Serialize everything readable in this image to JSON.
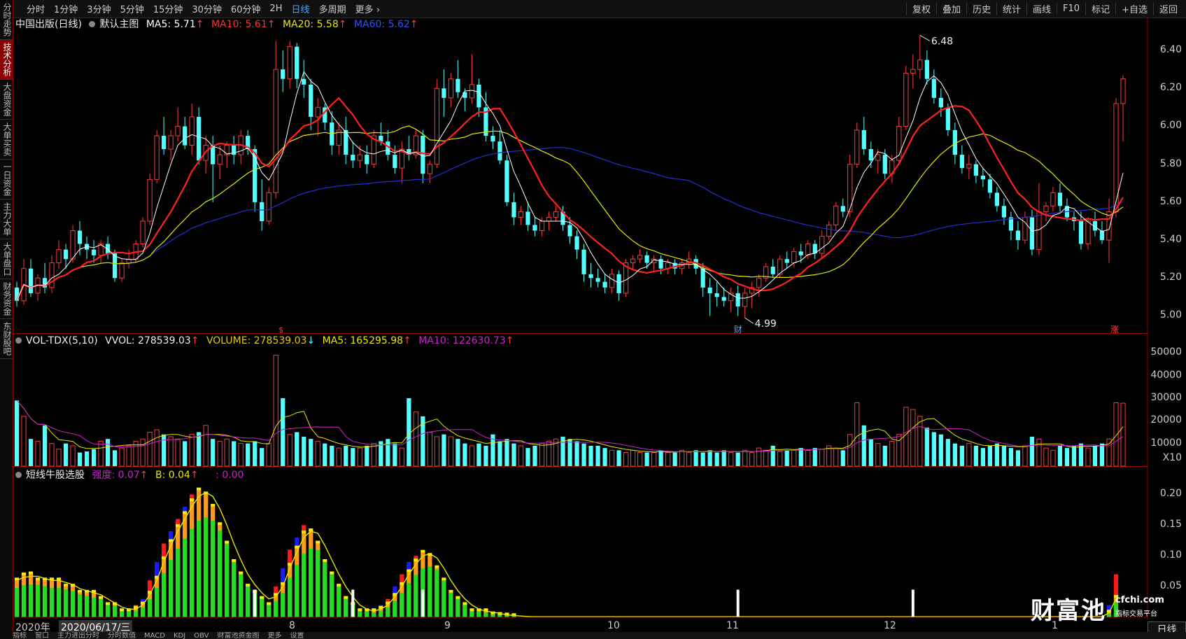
{
  "toolbar": {
    "periods": [
      "分时",
      "1分钟",
      "3分钟",
      "5分钟",
      "15分钟",
      "30分钟",
      "60分钟",
      "2H",
      "日线",
      "多周期",
      "更多"
    ],
    "tools": [
      "复权",
      "叠加",
      "历史",
      "统计",
      "画线",
      "F10",
      "标记",
      "+自选",
      "返回"
    ]
  },
  "sidebar": [
    "分时走势",
    "技术分析",
    "大盘资金",
    "大单买卖",
    "一日资金",
    "主力大单",
    "大单盘口",
    "财务资金",
    "东财股吧"
  ],
  "main_legend": {
    "name": "中国出版(日线)",
    "indicator": "默认主图",
    "ma5": "MA5: 5.71",
    "ma10": "MA10: 5.61",
    "ma20": "MA20: 5.58",
    "ma60": "MA60: 5.62",
    "arrow": "↑"
  },
  "vol_legend": {
    "name": "VOL-TDX(5,10)",
    "vvol": "VVOL: 278539.03",
    "volume": "VOLUME: 278539.03",
    "ma5": "MA5: 165295.98",
    "ma10": "MA10: 122630.73"
  },
  "ind_legend": {
    "name": "短线牛股选股",
    "strength": "强度: 0.07",
    "b": "B: 0.04",
    "blank": ": 0.00"
  },
  "price_axis": [
    "6.40",
    "6.20",
    "6.00",
    "5.80",
    "5.60",
    "5.40",
    "5.20",
    "5.00"
  ],
  "vol_axis": [
    "50000",
    "40000",
    "30000",
    "20000",
    "10000",
    "X10"
  ],
  "ind_axis": [
    "0.20",
    "0.15",
    "0.10",
    "0.05"
  ],
  "annotations": {
    "high": "6.48",
    "low": "4.99",
    "fin": "财",
    "up": "涨",
    "s_mark": "$"
  },
  "date_axis": {
    "year": "2020年",
    "cursor_date": "2020/06/17/三",
    "months": [
      "8",
      "9",
      "10",
      "11",
      "12",
      "1"
    ]
  },
  "right_bottom": "日线",
  "bottom_tabs": [
    "指标",
    "窗口",
    "主力进出分时",
    "分时数值",
    "MACD",
    "KDJ",
    "OBV",
    "财富池资金图",
    "更多",
    "设置"
  ],
  "watermark": {
    "logo": "财富池",
    "site": "cfchi.com",
    "sub": "指标交易平台"
  },
  "colors": {
    "up": "#ff3b3b",
    "down": "#54ffff",
    "ma5": "#ffffff",
    "ma10": "#ff2020",
    "ma20": "#e6e600",
    "ma60": "#2030d0",
    "vma10": "#d020d0",
    "accent": "#4aa3ff"
  },
  "chart_data": {
    "type": "candlestick",
    "price_range": [
      4.95,
      6.5
    ],
    "ohlc": [
      [
        5.15,
        5.18,
        5.05,
        5.08
      ],
      [
        5.08,
        5.3,
        5.06,
        5.25
      ],
      [
        5.25,
        5.3,
        5.1,
        5.12
      ],
      [
        5.12,
        5.22,
        5.08,
        5.2
      ],
      [
        5.2,
        5.28,
        5.12,
        5.15
      ],
      [
        5.15,
        5.32,
        5.12,
        5.28
      ],
      [
        5.28,
        5.4,
        5.25,
        5.35
      ],
      [
        5.35,
        5.38,
        5.25,
        5.3
      ],
      [
        5.3,
        5.48,
        5.28,
        5.45
      ],
      [
        5.45,
        5.5,
        5.32,
        5.38
      ],
      [
        5.38,
        5.42,
        5.3,
        5.35
      ],
      [
        5.35,
        5.4,
        5.28,
        5.32
      ],
      [
        5.32,
        5.4,
        5.28,
        5.38
      ],
      [
        5.38,
        5.42,
        5.3,
        5.33
      ],
      [
        5.33,
        5.35,
        5.18,
        5.2
      ],
      [
        5.2,
        5.3,
        5.18,
        5.28
      ],
      [
        5.28,
        5.35,
        5.25,
        5.3
      ],
      [
        5.3,
        5.4,
        5.28,
        5.38
      ],
      [
        5.38,
        5.52,
        5.36,
        5.5
      ],
      [
        5.5,
        5.75,
        5.48,
        5.72
      ],
      [
        5.72,
        5.98,
        5.7,
        5.95
      ],
      [
        5.95,
        6.05,
        5.85,
        5.88
      ],
      [
        5.88,
        5.98,
        5.82,
        5.95
      ],
      [
        5.95,
        6.1,
        5.92,
        6.0
      ],
      [
        6.0,
        6.05,
        5.88,
        5.9
      ],
      [
        5.9,
        6.12,
        5.85,
        6.05
      ],
      [
        6.05,
        6.1,
        5.8,
        5.82
      ],
      [
        5.82,
        5.95,
        5.75,
        5.9
      ],
      [
        5.9,
        5.95,
        5.6,
        5.8
      ],
      [
        5.8,
        5.9,
        5.72,
        5.85
      ],
      [
        5.85,
        5.92,
        5.78,
        5.9
      ],
      [
        5.9,
        5.95,
        5.8,
        5.85
      ],
      [
        5.85,
        5.98,
        5.8,
        5.95
      ],
      [
        5.95,
        5.98,
        5.85,
        5.88
      ],
      [
        5.88,
        5.9,
        5.55,
        5.6
      ],
      [
        5.6,
        5.72,
        5.45,
        5.5
      ],
      [
        5.5,
        5.68,
        5.48,
        5.65
      ],
      [
        5.65,
        6.45,
        5.62,
        6.3
      ],
      [
        6.3,
        6.4,
        6.18,
        6.25
      ],
      [
        6.25,
        6.45,
        6.2,
        6.42
      ],
      [
        6.42,
        6.44,
        6.2,
        6.25
      ],
      [
        6.25,
        6.35,
        6.15,
        6.22
      ],
      [
        6.22,
        6.25,
        5.98,
        6.05
      ],
      [
        6.05,
        6.15,
        5.95,
        6.1
      ],
      [
        6.1,
        6.12,
        5.98,
        6.02
      ],
      [
        6.02,
        6.08,
        5.85,
        5.9
      ],
      [
        5.9,
        6.02,
        5.85,
        5.98
      ],
      [
        5.98,
        6.05,
        5.8,
        5.85
      ],
      [
        5.85,
        5.92,
        5.78,
        5.82
      ],
      [
        5.82,
        5.9,
        5.78,
        5.85
      ],
      [
        5.85,
        5.9,
        5.75,
        5.8
      ],
      [
        5.8,
        5.98,
        5.78,
        5.95
      ],
      [
        5.95,
        6.02,
        5.9,
        5.92
      ],
      [
        5.92,
        5.98,
        5.82,
        5.85
      ],
      [
        5.85,
        5.9,
        5.75,
        5.78
      ],
      [
        5.78,
        5.92,
        5.7,
        5.88
      ],
      [
        5.88,
        5.95,
        5.82,
        5.85
      ],
      [
        5.85,
        5.98,
        5.83,
        5.95
      ],
      [
        5.95,
        5.98,
        5.7,
        5.75
      ],
      [
        5.75,
        5.82,
        5.7,
        5.8
      ],
      [
        5.8,
        6.25,
        5.78,
        6.2
      ],
      [
        6.2,
        6.3,
        6.05,
        6.15
      ],
      [
        6.15,
        6.28,
        6.1,
        6.25
      ],
      [
        6.25,
        6.35,
        6.15,
        6.18
      ],
      [
        6.18,
        6.2,
        6.08,
        6.15
      ],
      [
        6.15,
        6.38,
        6.12,
        6.22
      ],
      [
        6.22,
        6.25,
        6.05,
        6.1
      ],
      [
        6.1,
        6.18,
        5.92,
        5.95
      ],
      [
        5.95,
        6.0,
        5.88,
        5.92
      ],
      [
        5.92,
        5.98,
        5.8,
        5.82
      ],
      [
        5.82,
        5.85,
        5.58,
        5.6
      ],
      [
        5.6,
        5.65,
        5.48,
        5.52
      ],
      [
        5.52,
        5.58,
        5.48,
        5.55
      ],
      [
        5.55,
        5.6,
        5.45,
        5.48
      ],
      [
        5.48,
        5.52,
        5.42,
        5.45
      ],
      [
        5.45,
        5.52,
        5.42,
        5.5
      ],
      [
        5.5,
        5.55,
        5.45,
        5.52
      ],
      [
        5.52,
        5.58,
        5.5,
        5.55
      ],
      [
        5.55,
        5.58,
        5.45,
        5.48
      ],
      [
        5.48,
        5.52,
        5.38,
        5.42
      ],
      [
        5.42,
        5.45,
        5.3,
        5.35
      ],
      [
        5.35,
        5.38,
        5.18,
        5.22
      ],
      [
        5.22,
        5.28,
        5.15,
        5.2
      ],
      [
        5.2,
        5.25,
        5.15,
        5.18
      ],
      [
        5.18,
        5.22,
        5.12,
        5.15
      ],
      [
        5.15,
        5.25,
        5.12,
        5.22
      ],
      [
        5.22,
        5.24,
        5.08,
        5.12
      ],
      [
        5.12,
        5.3,
        5.1,
        5.28
      ],
      [
        5.28,
        5.32,
        5.25,
        5.3
      ],
      [
        5.3,
        5.35,
        5.28,
        5.32
      ],
      [
        5.32,
        5.34,
        5.25,
        5.28
      ],
      [
        5.28,
        5.32,
        5.24,
        5.3
      ],
      [
        5.3,
        5.32,
        5.22,
        5.25
      ],
      [
        5.25,
        5.3,
        5.22,
        5.28
      ],
      [
        5.28,
        5.3,
        5.22,
        5.25
      ],
      [
        5.25,
        5.3,
        5.22,
        5.28
      ],
      [
        5.28,
        5.34,
        5.25,
        5.3
      ],
      [
        5.3,
        5.32,
        5.22,
        5.25
      ],
      [
        5.25,
        5.28,
        5.1,
        5.15
      ],
      [
        5.15,
        5.2,
        5.0,
        5.12
      ],
      [
        5.12,
        5.18,
        5.05,
        5.1
      ],
      [
        5.1,
        5.15,
        5.05,
        5.08
      ],
      [
        5.08,
        5.15,
        5.02,
        5.12
      ],
      [
        5.12,
        5.16,
        5.0,
        5.05
      ],
      [
        5.05,
        5.15,
        4.99,
        5.12
      ],
      [
        5.12,
        5.18,
        5.04,
        5.15
      ],
      [
        5.15,
        5.22,
        5.1,
        5.2
      ],
      [
        5.2,
        5.28,
        5.18,
        5.26
      ],
      [
        5.26,
        5.3,
        5.2,
        5.22
      ],
      [
        5.22,
        5.32,
        5.2,
        5.3
      ],
      [
        5.3,
        5.34,
        5.25,
        5.28
      ],
      [
        5.28,
        5.36,
        5.26,
        5.34
      ],
      [
        5.34,
        5.38,
        5.28,
        5.32
      ],
      [
        5.32,
        5.4,
        5.3,
        5.38
      ],
      [
        5.38,
        5.4,
        5.3,
        5.33
      ],
      [
        5.33,
        5.45,
        5.3,
        5.42
      ],
      [
        5.42,
        5.5,
        5.4,
        5.48
      ],
      [
        5.48,
        5.6,
        5.45,
        5.58
      ],
      [
        5.58,
        5.62,
        5.52,
        5.55
      ],
      [
        5.55,
        5.85,
        5.52,
        5.8
      ],
      [
        5.8,
        6.02,
        5.78,
        5.98
      ],
      [
        5.98,
        6.05,
        5.85,
        5.88
      ],
      [
        5.88,
        5.92,
        5.78,
        5.82
      ],
      [
        5.82,
        5.88,
        5.75,
        5.85
      ],
      [
        5.85,
        5.88,
        5.72,
        5.75
      ],
      [
        5.75,
        5.85,
        5.7,
        5.82
      ],
      [
        5.82,
        6.05,
        5.8,
        6.0
      ],
      [
        6.0,
        6.32,
        5.98,
        6.28
      ],
      [
        6.28,
        6.38,
        6.2,
        6.3
      ],
      [
        6.3,
        6.48,
        6.25,
        6.35
      ],
      [
        6.35,
        6.4,
        6.22,
        6.25
      ],
      [
        6.25,
        6.3,
        6.12,
        6.15
      ],
      [
        6.15,
        6.2,
        6.05,
        6.1
      ],
      [
        6.1,
        6.12,
        5.95,
        5.98
      ],
      [
        5.98,
        6.02,
        5.8,
        5.85
      ],
      [
        5.85,
        5.9,
        5.75,
        5.78
      ],
      [
        5.78,
        5.85,
        5.72,
        5.8
      ],
      [
        5.8,
        5.82,
        5.7,
        5.74
      ],
      [
        5.74,
        5.78,
        5.68,
        5.72
      ],
      [
        5.72,
        5.75,
        5.62,
        5.65
      ],
      [
        5.65,
        5.68,
        5.55,
        5.58
      ],
      [
        5.58,
        5.62,
        5.48,
        5.52
      ],
      [
        5.52,
        5.55,
        5.4,
        5.45
      ],
      [
        5.45,
        5.5,
        5.35,
        5.4
      ],
      [
        5.4,
        5.55,
        5.38,
        5.52
      ],
      [
        5.52,
        5.56,
        5.32,
        5.35
      ],
      [
        5.35,
        5.7,
        5.32,
        5.55
      ],
      [
        5.55,
        5.6,
        5.5,
        5.58
      ],
      [
        5.58,
        5.68,
        5.55,
        5.65
      ],
      [
        5.65,
        5.7,
        5.55,
        5.58
      ],
      [
        5.58,
        5.62,
        5.5,
        5.52
      ],
      [
        5.52,
        5.55,
        5.45,
        5.5
      ],
      [
        5.5,
        5.55,
        5.35,
        5.38
      ],
      [
        5.38,
        5.52,
        5.35,
        5.5
      ],
      [
        5.5,
        5.55,
        5.42,
        5.45
      ],
      [
        5.45,
        5.5,
        5.38,
        5.4
      ],
      [
        5.4,
        5.62,
        5.28,
        5.55
      ],
      [
        5.55,
        6.15,
        5.52,
        6.12
      ],
      [
        6.12,
        6.27,
        5.92,
        6.25
      ]
    ],
    "volume": [
      29000,
      22000,
      12000,
      11000,
      18000,
      10000,
      7500,
      10000,
      9000,
      6000,
      6500,
      7500,
      11000,
      12000,
      7000,
      8000,
      9000,
      11000,
      12000,
      15000,
      16000,
      14000,
      13000,
      12000,
      11000,
      14000,
      15000,
      18000,
      12000,
      11000,
      12000,
      11000,
      10000,
      10000,
      11000,
      8000,
      10000,
      49000,
      30000,
      14000,
      15000,
      13000,
      12000,
      11000,
      10000,
      9000,
      8000,
      9000,
      8000,
      8000,
      9000,
      10000,
      11000,
      12000,
      10000,
      8000,
      30000,
      24000,
      22000,
      15000,
      13000,
      14000,
      13000,
      12000,
      10000,
      9000,
      10000,
      9000,
      14000,
      11000,
      12000,
      10000,
      9000,
      8000,
      9000,
      10000,
      11000,
      12000,
      13000,
      12000,
      11000,
      10000,
      9000,
      9000,
      8000,
      7000,
      7000,
      6000,
      7000,
      6000,
      6000,
      6000,
      7000,
      6000,
      6000,
      7000,
      6000,
      7000,
      6000,
      7000,
      6000,
      7000,
      6000,
      6000,
      7000,
      6000,
      8000,
      7000,
      9000,
      6500,
      7000,
      7000,
      8000,
      7000,
      8000,
      7500,
      9000,
      8000,
      7000,
      14000,
      28000,
      18000,
      12000,
      10000,
      9000,
      11000,
      14000,
      26000,
      25000,
      22000,
      17000,
      15000,
      14000,
      12000,
      10000,
      9000,
      10000,
      9000,
      8000,
      9000,
      10000,
      9000,
      8000,
      7000,
      9000,
      13000,
      12000,
      8000,
      7000,
      9000,
      8000,
      9000,
      10000,
      8000,
      9000,
      10000,
      12000,
      28000,
      27800
    ],
    "strength": [
      0.06,
      0.07,
      0.07,
      0.06,
      0.06,
      0.06,
      0.06,
      0.05,
      0.05,
      0.04,
      0.04,
      0.04,
      0.03,
      0.02,
      0.02,
      0.01,
      0.01,
      0.02,
      0.03,
      0.06,
      0.09,
      0.12,
      0.14,
      0.16,
      0.18,
      0.2,
      0.21,
      0.2,
      0.18,
      0.15,
      0.12,
      0.09,
      0.07,
      0.05,
      0.04,
      0.03,
      0.02,
      0.05,
      0.08,
      0.11,
      0.13,
      0.15,
      0.14,
      0.12,
      0.09,
      0.07,
      0.05,
      0.03,
      0.02,
      0.01,
      0.01,
      0.01,
      0.02,
      0.03,
      0.05,
      0.07,
      0.09,
      0.1,
      0.11,
      0.1,
      0.08,
      0.06,
      0.04,
      0.03,
      0.02,
      0.01,
      0.01,
      0.01,
      0.005,
      0.004,
      0.003,
      0.002,
      0.001,
      0.001,
      0.001,
      0.001,
      0.001,
      0.001,
      0.001,
      0.001,
      0.001,
      0.001,
      0.001,
      0.001,
      0.001,
      0.001,
      0.001,
      0.001,
      0.001,
      0.001,
      0.001,
      0.001,
      0.001,
      0.001,
      0.001,
      0.001,
      0.001,
      0.001,
      0.001,
      0.001,
      0.001,
      0.001,
      0.001,
      0.001,
      0.001,
      0.001,
      0.001,
      0.001,
      0.001,
      0.001,
      0.001,
      0.001,
      0.001,
      0.001,
      0.001,
      0.001,
      0.001,
      0.001,
      0.001,
      0.001,
      0.001,
      0.001,
      0.001,
      0.001,
      0.001,
      0.001,
      0.001,
      0.001,
      0.001,
      0.001,
      0.001,
      0.001,
      0.001,
      0.001,
      0.001,
      0.001,
      0.001,
      0.001,
      0.001,
      0.001,
      0.001,
      0.001,
      0.001,
      0.001,
      0.001,
      0.001,
      0.001,
      0.001,
      0.001,
      0.001,
      0.001,
      0.001,
      0.001,
      0.001,
      0.001,
      0.001,
      0.02,
      0.07
    ],
    "white_markers": [
      34,
      48,
      58,
      103,
      128
    ]
  }
}
